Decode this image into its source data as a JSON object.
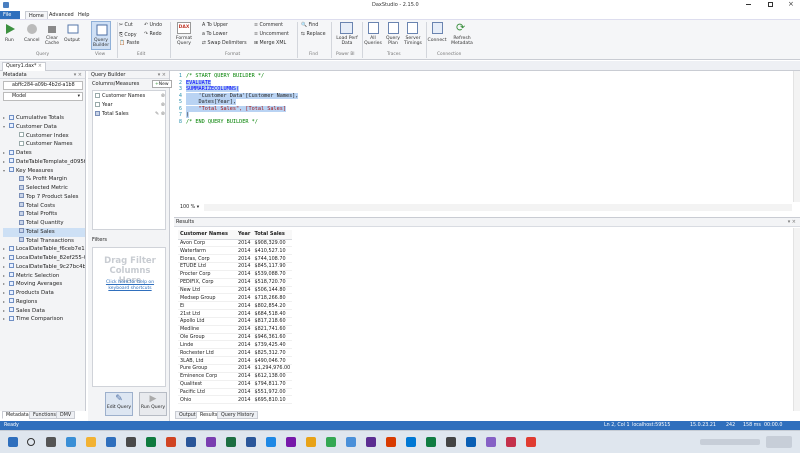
{
  "window": {
    "title": "DaxStudio - 2.15.0"
  },
  "ribbon_tabs": [
    "File",
    "Home",
    "Advanced",
    "Help"
  ],
  "ribbon": {
    "run": "Run",
    "cancel": "Cancel",
    "clear_cache": "Clear Cache",
    "output": "Output",
    "query_builder": "Query Builder",
    "cut": "Cut",
    "copy": "Copy",
    "paste": "Paste",
    "undo": "Undo",
    "redo": "Redo",
    "format_query": "Format Query",
    "to_upper": "To Upper",
    "to_lower": "To Lower",
    "swap_delimiters": "Swap Delimiters",
    "comment": "Comment",
    "uncomment": "Uncomment",
    "merge_xml": "Merge XML",
    "find": "Find",
    "replace": "Replace",
    "load_perf_data": "Load Perf Data",
    "all_queries": "All Queries",
    "query_plan": "Query Plan",
    "server_timings": "Server Timings",
    "connect": "Connect",
    "refresh_metadata": "Refresh Metadata",
    "groups": [
      "Query",
      "View",
      "Edit",
      "Format",
      "Find",
      "Power BI",
      "Traces",
      "Connection"
    ]
  },
  "doc_tab": "Query1.dax*",
  "metadata": {
    "title": "Metadata",
    "db": "abffc284-a09b-4b2d-a1b8",
    "model": "Model",
    "items": [
      {
        "label": "Cumulative Totals",
        "indent": 0,
        "arrow": "▸",
        "icon": "tbl"
      },
      {
        "label": "Customer Data",
        "indent": 0,
        "arrow": "▾",
        "icon": "tbl"
      },
      {
        "label": "Customer Index",
        "indent": 1,
        "arrow": "",
        "icon": "col"
      },
      {
        "label": "Customer Names",
        "indent": 1,
        "arrow": "",
        "icon": "col"
      },
      {
        "label": "Dates",
        "indent": 0,
        "arrow": "▸",
        "icon": "tbl"
      },
      {
        "label": "DateTableTemplate_d095fb",
        "indent": 0,
        "arrow": "▸",
        "icon": "tbl"
      },
      {
        "label": "Key Measures",
        "indent": 0,
        "arrow": "▾",
        "icon": "tbl"
      },
      {
        "label": "% Profit Margin",
        "indent": 1,
        "arrow": "",
        "icon": "m"
      },
      {
        "label": "Selected Metric",
        "indent": 1,
        "arrow": "",
        "icon": "m"
      },
      {
        "label": "Top 7 Product Sales",
        "indent": 1,
        "arrow": "",
        "icon": "m"
      },
      {
        "label": "Total Costs",
        "indent": 1,
        "arrow": "",
        "icon": "m"
      },
      {
        "label": "Total Profits",
        "indent": 1,
        "arrow": "",
        "icon": "m"
      },
      {
        "label": "Total Quantity",
        "indent": 1,
        "arrow": "",
        "icon": "m"
      },
      {
        "label": "Total Sales",
        "indent": 1,
        "arrow": "",
        "icon": "m",
        "selected": true
      },
      {
        "label": "Total Transactions",
        "indent": 1,
        "arrow": "",
        "icon": "m"
      },
      {
        "label": "LocalDateTable_f6ceb7e1-",
        "indent": 0,
        "arrow": "▸",
        "icon": "tbl"
      },
      {
        "label": "LocalDateTable_82ef255-0",
        "indent": 0,
        "arrow": "▸",
        "icon": "tbl"
      },
      {
        "label": "LocalDateTable_9c27bc4b-",
        "indent": 0,
        "arrow": "▸",
        "icon": "tbl"
      },
      {
        "label": "Metric Selection",
        "indent": 0,
        "arrow": "▸",
        "icon": "tbl"
      },
      {
        "label": "Moving Averages",
        "indent": 0,
        "arrow": "▸",
        "icon": "tbl"
      },
      {
        "label": "Products Data",
        "indent": 0,
        "arrow": "▸",
        "icon": "tbl"
      },
      {
        "label": "Regions",
        "indent": 0,
        "arrow": "▸",
        "icon": "tbl"
      },
      {
        "label": "Sales Data",
        "indent": 0,
        "arrow": "▸",
        "icon": "tbl"
      },
      {
        "label": "Time Comparison",
        "indent": 0,
        "arrow": "▸",
        "icon": "tbl"
      }
    ],
    "bottom_tabs": [
      "Metadata",
      "Functions",
      "DMV"
    ]
  },
  "query_builder": {
    "title": "Query Builder",
    "section": "Columns/Measures",
    "new": "New",
    "items": [
      "Customer Names",
      "Year",
      "Total Sales"
    ],
    "filters": "Filters",
    "drag_hint": "Drag Filter Columns Here",
    "help_link": "Click here for help on keyboard shortcuts",
    "edit_query": "Edit Query",
    "run_query": "Run Query"
  },
  "editor": {
    "lines": [
      "/* START QUERY BUILDER */",
      "EVALUATE",
      "SUMMARIZECOLUMNS(",
      "    'Customer Data'[Customer Names],",
      "    Dates[Year],",
      "    \"Total Sales\", [Total Sales]",
      ")",
      "/* END QUERY BUILDER */"
    ],
    "zoom": "100 %"
  },
  "results": {
    "title": "Results",
    "columns": [
      "Customer Names",
      "Year",
      "Total Sales"
    ],
    "rows": [
      [
        "Avon Corp",
        "2014",
        "$908,329.00"
      ],
      [
        "Waterfarm",
        "2014",
        "$410,527.10"
      ],
      [
        "Eloras, Corp",
        "2014",
        "$744,108.70"
      ],
      [
        "ETUDE Ltd",
        "2014",
        "$845,117.90"
      ],
      [
        "Procter Corp",
        "2014",
        "$539,088.70"
      ],
      [
        "PEDIFIX, Corp",
        "2014",
        "$518,720.70"
      ],
      [
        "New Ltd",
        "2014",
        "$506,144.80"
      ],
      [
        "Medsep Group",
        "2014",
        "$718,266.80"
      ],
      [
        "Ei",
        "2014",
        "$802,854.20"
      ],
      [
        "21st Ltd",
        "2014",
        "$684,518.40"
      ],
      [
        "Apollo Ltd",
        "2014",
        "$817,218.60"
      ],
      [
        "Medline",
        "2014",
        "$821,741.60"
      ],
      [
        "Ole Group",
        "2014",
        "$946,361.60"
      ],
      [
        "Linde",
        "2014",
        "$739,425.40"
      ],
      [
        "Rochester Ltd",
        "2014",
        "$825,312.70"
      ],
      [
        "3LAB, Ltd",
        "2014",
        "$490,046.70"
      ],
      [
        "Pure Group",
        "2014",
        "$1,294,976.00"
      ],
      [
        "Eminence Corp",
        "2014",
        "$612,138.00"
      ],
      [
        "Qualitest",
        "2014",
        "$794,811.70"
      ],
      [
        "Pacific Ltd",
        "2014",
        "$551,972.00"
      ],
      [
        "Ohio",
        "2014",
        "$695,810.10"
      ]
    ],
    "tabs": [
      "Output",
      "Results",
      "Query History"
    ]
  },
  "status": {
    "left": "Ready",
    "pos": "Ln 2, Col 1",
    "server": "localhost:59515",
    "version": "15.0.23.21",
    "rows": "242",
    "time": "158 ms",
    "dur": "00:00.0"
  },
  "colors": {
    "accent": "#2f6fbd",
    "selection": "#b9d3f3",
    "keyword": "#0000ff",
    "comment": "#008000",
    "string": "#a31515"
  }
}
